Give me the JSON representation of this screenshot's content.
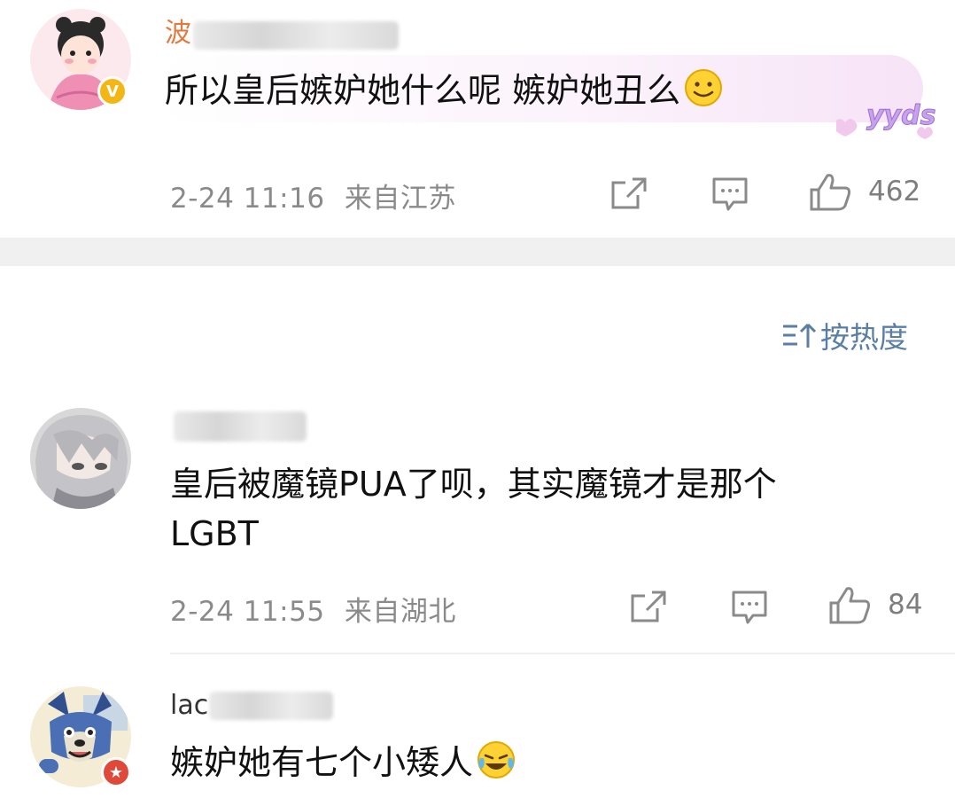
{
  "comments": [
    {
      "username_visible": "波",
      "text": "所以皇后嫉妒她什么呢 嫉妒她丑么",
      "time": "2-24 11:16",
      "location": "来自江苏",
      "likes": "462",
      "badge_icon": "verified-v-badge",
      "decoration": "yyds"
    },
    {
      "username_visible": "",
      "text_line1": "皇后被魔镜PUA了呗，其实魔镜才是那个",
      "text_line2": "LGBT",
      "time": "2-24 11:55",
      "location": "来自湖北",
      "likes": "84"
    },
    {
      "username_visible": "lac",
      "text": "嫉妒她有七个小矮人",
      "badge_icon": "red-star-badge"
    }
  ],
  "sort": {
    "label": "按热度",
    "icon": "sort-icon"
  },
  "colors": {
    "meta": "#8a8a8a",
    "sort_accent": "#5b7ea6",
    "badge_yellow": "#f3b614",
    "badge_red": "#e0493a",
    "divider": "#f0f0f0"
  }
}
